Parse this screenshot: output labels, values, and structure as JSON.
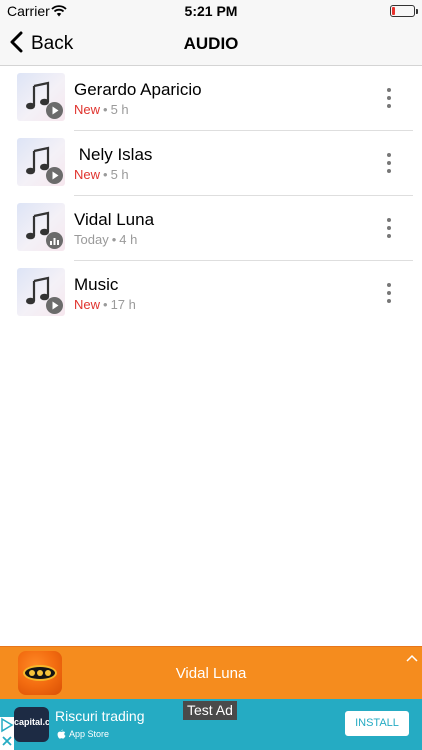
{
  "status_bar": {
    "carrier": "Carrier",
    "time": "5:21 PM",
    "battery_level": 0.12,
    "battery_color": "#e8322c"
  },
  "nav": {
    "back_label": "Back",
    "back_icon": "chevron-left-icon",
    "title": "AUDIO"
  },
  "items": [
    {
      "title": "Gerardo Aparicio",
      "status": "New",
      "status_color": "#e0332d",
      "age": "5 h",
      "badge_icon": "play-icon",
      "menu_icon": "more-vertical-icon"
    },
    {
      "title": " Nely Islas",
      "status": "New",
      "status_color": "#e0332d",
      "age": "5 h",
      "badge_icon": "play-icon",
      "menu_icon": "more-vertical-icon"
    },
    {
      "title": "Vidal Luna",
      "status": "Today",
      "status_color": "#9a9a9a",
      "age": "4 h",
      "badge_icon": "equalizer-icon",
      "menu_icon": "more-vertical-icon"
    },
    {
      "title": "Music",
      "status": "New",
      "status_color": "#e0332d",
      "age": "17 h",
      "badge_icon": "play-icon",
      "menu_icon": "more-vertical-icon"
    }
  ],
  "meta_separator": "•",
  "player": {
    "title": "Vidal Luna",
    "expand_icon": "chevron-up-icon",
    "background": "#f58c1e"
  },
  "ad": {
    "label": "Test Ad",
    "advertiser_logo": "capital.com",
    "title": "Riscuri trading",
    "store": "App Store",
    "install_label": "INSTALL",
    "background": "#25abc3"
  }
}
